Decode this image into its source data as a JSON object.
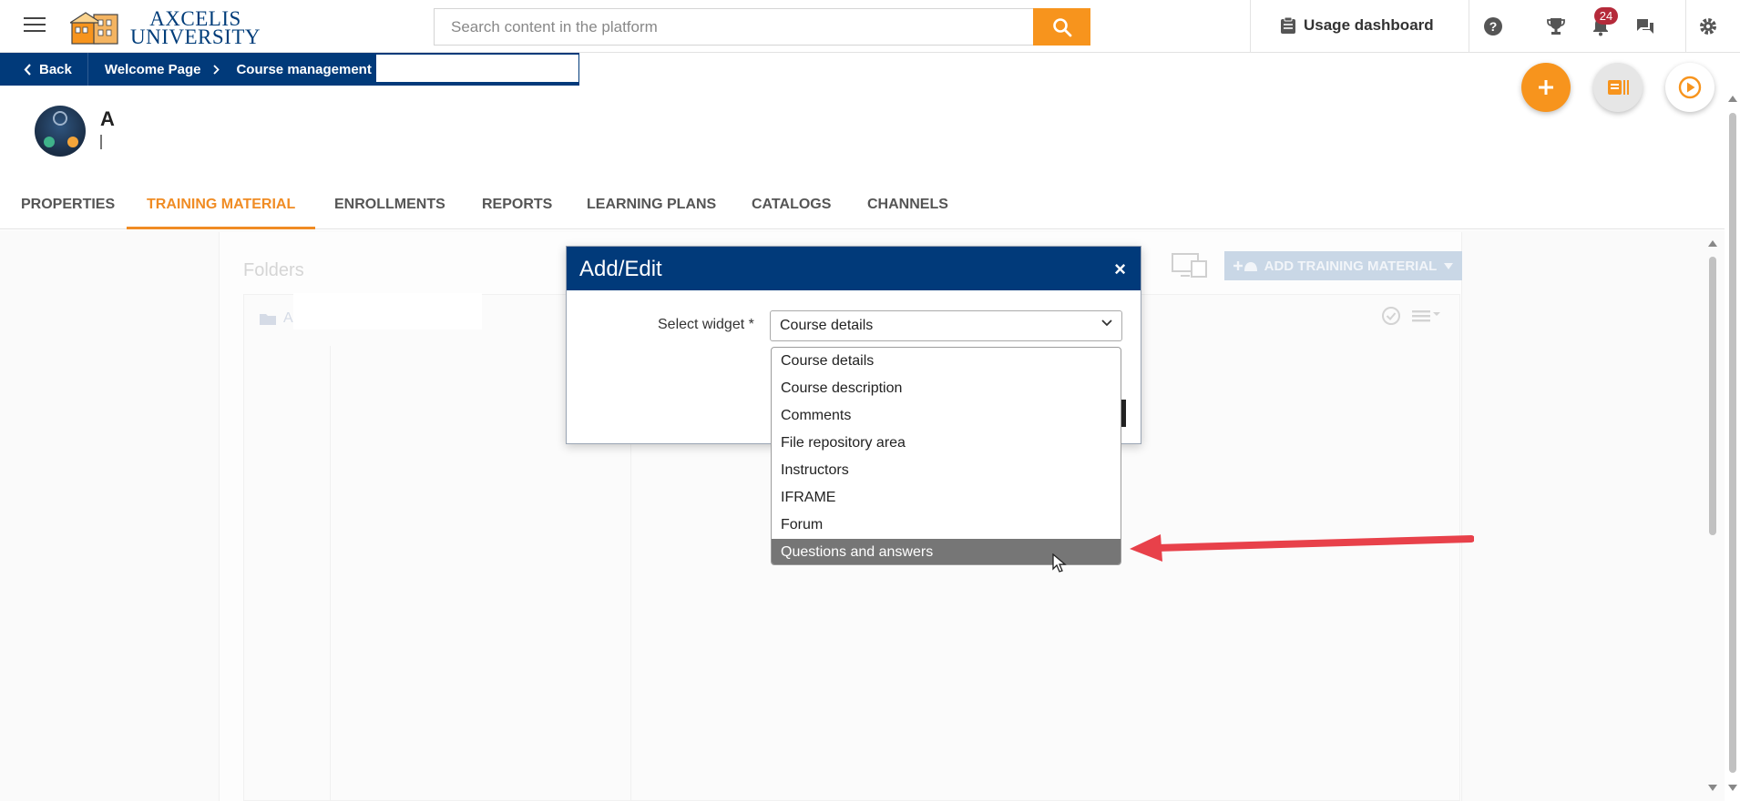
{
  "header": {
    "logo_line1": "AXCELIS",
    "logo_line2": "UNIVERSITY",
    "search_placeholder": "Search content in the platform",
    "usage_label": "Usage dashboard",
    "notification_count": "24"
  },
  "breadcrumb": {
    "back_label": "Back",
    "items": [
      "Welcome Page",
      "Course management"
    ]
  },
  "course": {
    "title_initial": "A"
  },
  "tabs": [
    {
      "label": "PROPERTIES",
      "active": false
    },
    {
      "label": "TRAINING MATERIAL",
      "active": true
    },
    {
      "label": "ENROLLMENTS",
      "active": false
    },
    {
      "label": "REPORTS",
      "active": false
    },
    {
      "label": "LEARNING PLANS",
      "active": false
    },
    {
      "label": "CATALOGS",
      "active": false
    },
    {
      "label": "CHANNELS",
      "active": false
    }
  ],
  "content": {
    "folders_title": "Folders",
    "folder_initial": "A",
    "add_material_label": "ADD TRAINING MATERIAL"
  },
  "modal": {
    "title": "Add/Edit",
    "close_glyph": "×",
    "select_label": "Select widget *",
    "selected_value": "Course details",
    "options": [
      "Course details",
      "Course description",
      "Comments",
      "File repository area",
      "Instructors",
      "IFRAME",
      "Forum",
      "Questions and answers"
    ],
    "highlighted_option": "Questions and answers"
  },
  "colors": {
    "brand_navy": "#013a7a",
    "accent_orange": "#f7941d",
    "annotation_arrow": "#e8414a",
    "highlight_grey": "#767676"
  }
}
